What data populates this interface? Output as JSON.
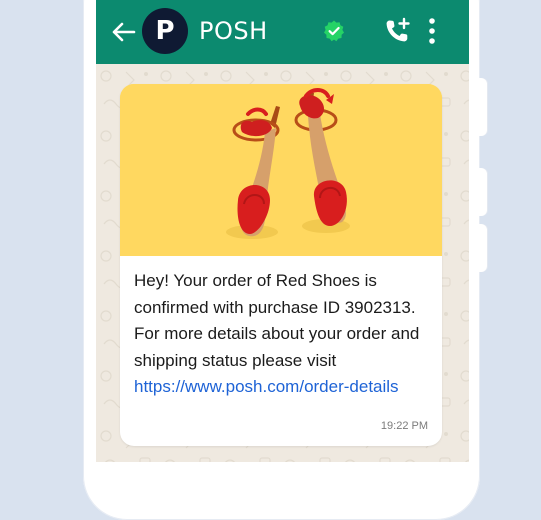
{
  "header": {
    "back_icon": "arrow-left-icon",
    "avatar_letter": "P",
    "business_name": "POSH",
    "verified_icon": "verified-badge-icon",
    "call_icon": "add-call-icon",
    "menu_icon": "more-vertical-icon"
  },
  "message": {
    "image": "red-heeled-sandals-photo",
    "text": "Hey! Your order of Red Shoes is\nconfirmed with purchase ID 3902313.\nFor more details about your order and\nshipping status please visit",
    "link": "https://www.posh.com/order-details",
    "time": "19:22 PM"
  },
  "colors": {
    "header": "#0c8a6f",
    "verified": "#25d366",
    "chat_background": "#efe9e0",
    "link": "#1e63d6",
    "media_background": "#ffd860",
    "shoe": "#d81e1e",
    "avatar": "#0f1a33"
  }
}
